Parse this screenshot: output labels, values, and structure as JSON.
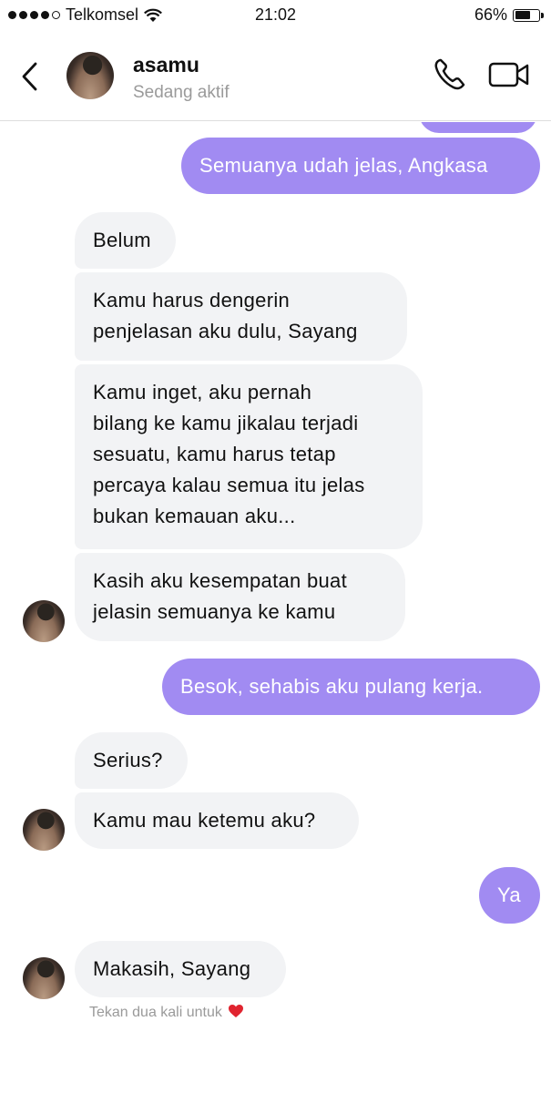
{
  "status_bar": {
    "carrier": "Telkomsel",
    "time": "21:02",
    "battery_percent": "66%"
  },
  "header": {
    "contact_name": "asamu",
    "contact_status": "Sedang aktif"
  },
  "messages": [
    {
      "from": "me",
      "text": "Semuanya udah jelas, Angkasa"
    },
    {
      "from": "them",
      "text": "Belum"
    },
    {
      "from": "them",
      "text": "Kamu harus dengerin\npenjelasan aku dulu, Sayang"
    },
    {
      "from": "them",
      "text": "Kamu inget, aku pernah\nbilang ke kamu jikalau terjadi\nsesuatu, kamu harus tetap\npercaya kalau semua itu jelas\nbukan kemauan aku..."
    },
    {
      "from": "them",
      "text": "Kasih aku kesempatan buat\njelasin semuanya ke kamu"
    },
    {
      "from": "me",
      "text": "Besok, sehabis aku pulang kerja."
    },
    {
      "from": "them",
      "text": "Serius?"
    },
    {
      "from": "them",
      "text": "Kamu mau ketemu aku?"
    },
    {
      "from": "me",
      "text": "Ya"
    },
    {
      "from": "them",
      "text": "Makasih, Sayang"
    }
  ],
  "hint_text": "Tekan dua kali untuk",
  "colors": {
    "outgoing_bubble": "#a18bf2",
    "incoming_bubble": "#f2f3f5",
    "heart": "#e0242f"
  }
}
